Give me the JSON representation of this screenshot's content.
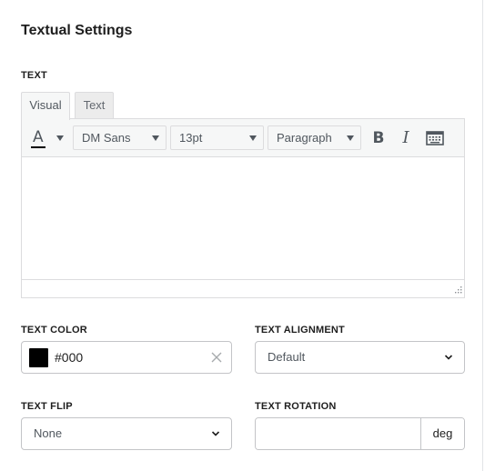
{
  "section": {
    "title": "Textual Settings"
  },
  "text_field": {
    "label": "TEXT",
    "tabs": [
      {
        "label": "Visual",
        "active": true
      },
      {
        "label": "Text",
        "active": false
      }
    ],
    "toolbar": {
      "text_color_letter": "A",
      "font_family": "DM Sans",
      "font_size": "13pt",
      "block_format": "Paragraph",
      "bold_label": "B",
      "italic_label": "I"
    },
    "content": ""
  },
  "text_color": {
    "label": "TEXT COLOR",
    "value": "#000",
    "swatch": "#000000"
  },
  "text_alignment": {
    "label": "TEXT ALIGNMENT",
    "selected": "Default"
  },
  "text_flip": {
    "label": "TEXT FLIP",
    "selected": "None"
  },
  "text_rotation": {
    "label": "TEXT ROTATION",
    "value": "",
    "unit": "deg"
  },
  "colors": {
    "border": "#c3c4c7",
    "toolbar_bg": "#f6f7f7",
    "text": "#1e1e1e"
  }
}
